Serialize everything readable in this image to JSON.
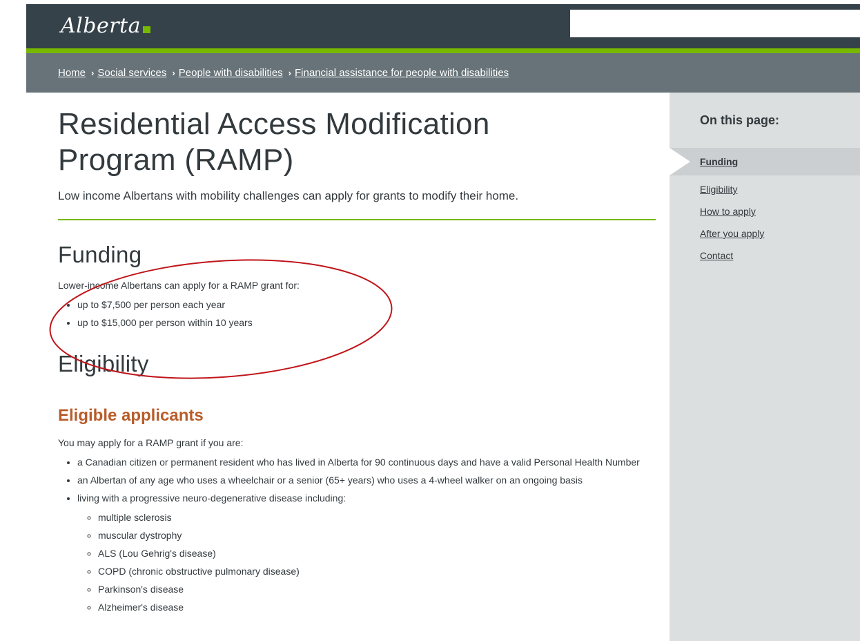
{
  "header": {
    "logo_text": "Alberta",
    "search": {
      "value": "",
      "placeholder": ""
    },
    "colors": {
      "topbar": "#36424a",
      "accent_green": "#77b800",
      "crumbbar": "#677378"
    }
  },
  "breadcrumb": {
    "items": [
      "Home",
      "Social services",
      "People with disabilities",
      "Financial assistance for people with disabilities"
    ],
    "separator": "›"
  },
  "main": {
    "title_line1": "Residential Access Modification",
    "title_line2": "Program (RAMP)",
    "lead": "Low income Albertans with mobility challenges can apply for grants to modify their home.",
    "funding": {
      "heading": "Funding",
      "intro": "Lower-income Albertans can apply for a RAMP grant for:",
      "items": [
        "up to $7,500 per person each year",
        "up to $15,000 per person within 10 years"
      ]
    },
    "eligibility": {
      "heading": "Eligibility",
      "subheading": "Eligible applicants",
      "intro": "You may apply for a RAMP grant if you are:",
      "items": [
        "a Canadian citizen or permanent resident who has lived in Alberta for 90 continuous days and have a valid Personal Health Number",
        "an Albertan of any age who uses a wheelchair or a senior (65+ years) who uses a 4-wheel walker on an ongoing basis",
        "living with a progressive neuro-degenerative disease including:"
      ],
      "diseases": [
        "multiple sclerosis",
        "muscular dystrophy",
        "ALS (Lou Gehrig's disease)",
        "COPD (chronic obstructive pulmonary disease)",
        "Parkinson's disease",
        "Alzheimer's disease"
      ]
    }
  },
  "sidebar": {
    "heading": "On this page:",
    "items": [
      "Funding",
      "Eligibility",
      "How to apply",
      "After you apply",
      "Contact"
    ],
    "active": "Funding"
  },
  "annotation": {
    "shape": "ellipse",
    "color": "#c0151a"
  }
}
